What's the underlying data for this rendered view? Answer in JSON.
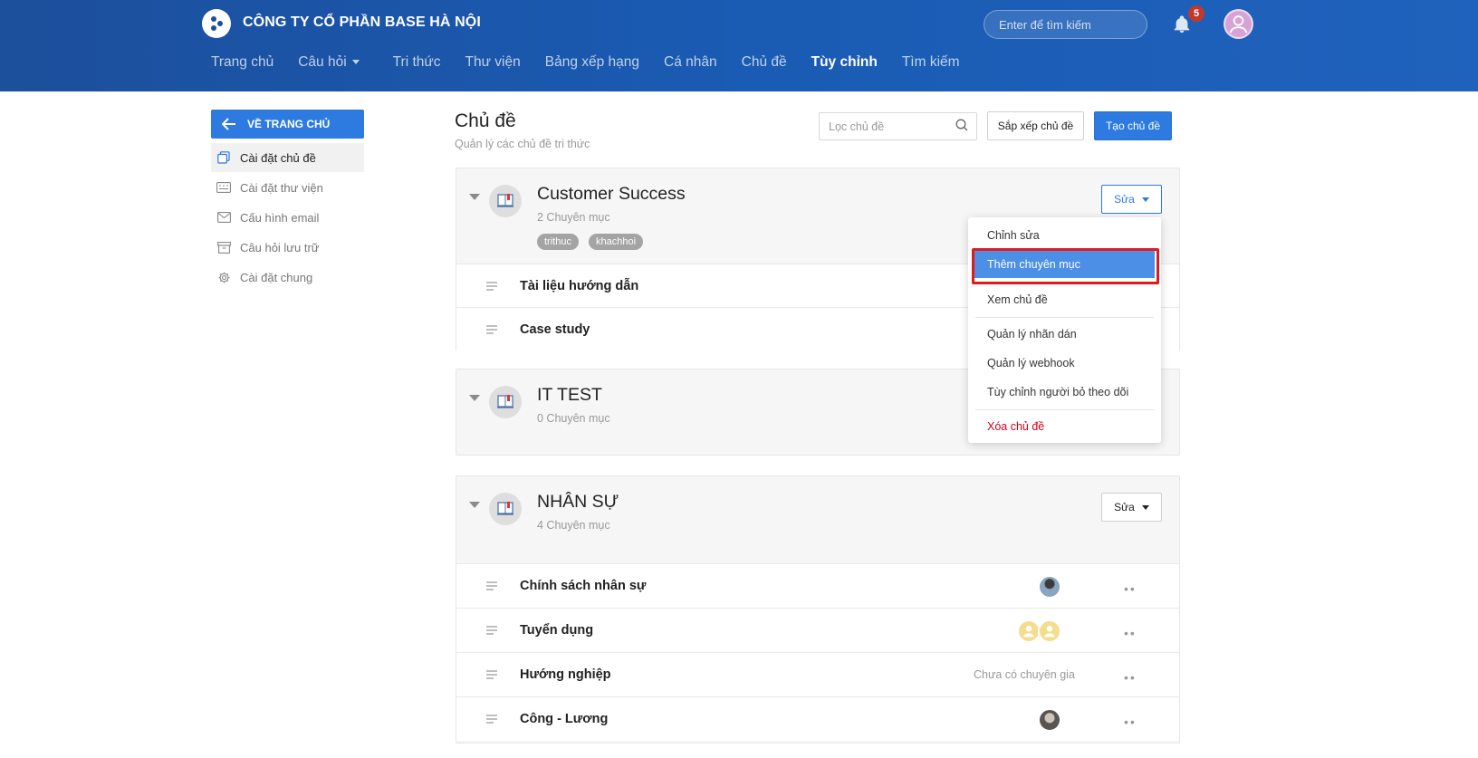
{
  "header": {
    "company": "CÔNG TY CỔ PHẦN BASE HÀ NỘI",
    "search_placeholder": "Enter để tìm kiếm",
    "notification_count": "5",
    "nav": [
      {
        "label": "Trang chủ"
      },
      {
        "label": "Câu hỏi"
      },
      {
        "label": "Tri thức"
      },
      {
        "label": "Thư viện"
      },
      {
        "label": "Bảng xếp hạng"
      },
      {
        "label": "Cá nhân"
      },
      {
        "label": "Chủ đề"
      },
      {
        "label": "Tùy chỉnh"
      },
      {
        "label": "Tìm kiếm"
      }
    ]
  },
  "sidebar": {
    "back_label": "VỀ TRANG CHỦ",
    "items": [
      {
        "label": "Cài đặt chủ đề"
      },
      {
        "label": "Cài đặt thư viện"
      },
      {
        "label": "Cấu hình email"
      },
      {
        "label": "Câu hỏi lưu trữ"
      },
      {
        "label": "Cài đặt chung"
      }
    ]
  },
  "main": {
    "title": "Chủ đề",
    "subtitle": "Quản lý các chủ đề tri thức",
    "filter_placeholder": "Lọc chủ đề",
    "sort_label": "Sắp xếp chủ đề",
    "create_label": "Tạo chủ đề",
    "edit_label": "Sửa",
    "topics": [
      {
        "title": "Customer Success",
        "count": "2 Chuyên mục",
        "tags": [
          "trithuc",
          "khachhoi"
        ],
        "rows": [
          {
            "name": "Tài liệu hướng dẫn"
          },
          {
            "name": "Case study"
          }
        ]
      },
      {
        "title": "IT TEST",
        "count": "0 Chuyên mục"
      },
      {
        "title": "NHÂN SỰ",
        "count": "4 Chuyên mục",
        "rows": [
          {
            "name": "Chính sách nhân sự"
          },
          {
            "name": "Tuyển dụng"
          },
          {
            "name": "Hướng nghiệp",
            "note": "Chưa có chuyên gia"
          },
          {
            "name": "Công - Lương"
          }
        ]
      }
    ]
  },
  "dropdown": {
    "items": [
      {
        "label": "Chỉnh sửa"
      },
      {
        "label": "Thêm chuyên mục"
      },
      {
        "label": "Xem chủ đề"
      },
      {
        "label": "Quản lý nhãn dán"
      },
      {
        "label": "Quản lý webhook"
      },
      {
        "label": "Tùy chỉnh người bỏ theo dõi"
      },
      {
        "label": "Xóa chủ đề"
      }
    ],
    "selected": "Thêm chuyên mục"
  },
  "colors": {
    "header": "#1c4f9c",
    "primary": "#2d7ae0",
    "danger": "#d0021b",
    "highlight_box": "#e01b1b"
  }
}
